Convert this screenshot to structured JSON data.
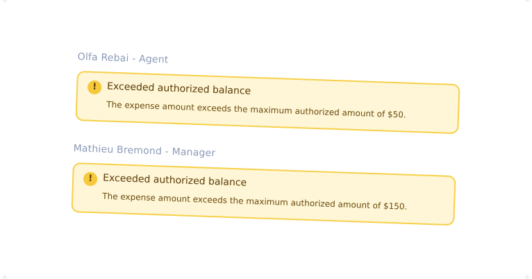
{
  "colors": {
    "label": "#8a9ab8",
    "alert_background": "#fef6d6",
    "alert_border": "#f7d04a",
    "alert_icon": "#f6c83b",
    "alert_text": "#5b3a06"
  },
  "approvals": [
    {
      "approver": "Olfa Rebai - Agent",
      "alert": {
        "icon": "exclamation-circle-icon",
        "icon_glyph": "!",
        "title": "Exceeded authorized balance",
        "message": "The expense amount exceeds the maximum authorized amount of $50."
      }
    },
    {
      "approver": "Mathieu Bremond - Manager",
      "alert": {
        "icon": "exclamation-circle-icon",
        "icon_glyph": "!",
        "title": "Exceeded authorized balance",
        "message": "The expense amount exceeds the maximum authorized amount of $150."
      }
    }
  ]
}
